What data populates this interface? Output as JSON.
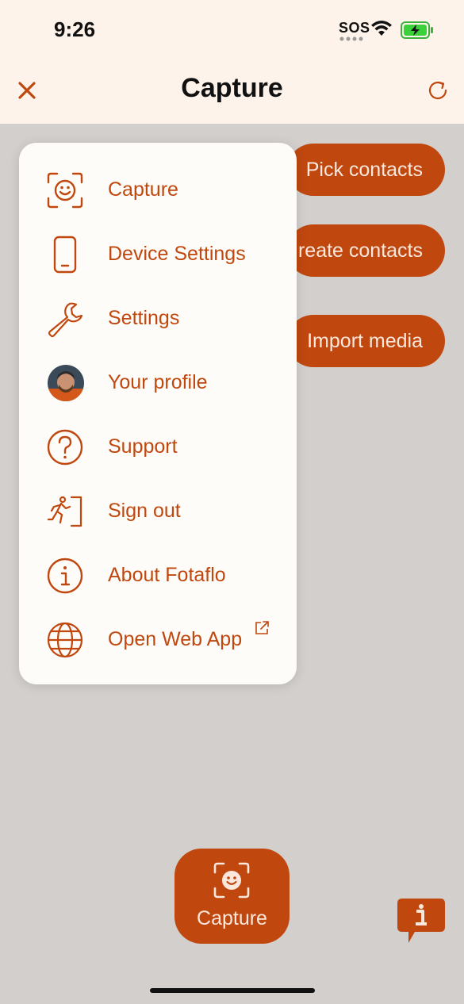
{
  "status_bar": {
    "time": "9:26",
    "sos": "SOS"
  },
  "header": {
    "title": "Capture",
    "close_icon": "close-icon",
    "refresh_icon": "refresh-icon"
  },
  "background_actions": [
    {
      "label": "Pick contacts"
    },
    {
      "label": "reate contacts"
    },
    {
      "label": "Import media"
    }
  ],
  "menu": {
    "items": [
      {
        "label": "Capture",
        "icon": "face-scan-icon"
      },
      {
        "label": "Device Settings",
        "icon": "phone-icon"
      },
      {
        "label": "Settings",
        "icon": "wrench-icon"
      },
      {
        "label": "Your profile",
        "icon": "avatar"
      },
      {
        "label": "Support",
        "icon": "question-icon"
      },
      {
        "label": "Sign out",
        "icon": "exit-icon"
      },
      {
        "label": "About Fotaflo",
        "icon": "info-icon"
      },
      {
        "label": "Open Web App",
        "icon": "globe-icon",
        "external": true
      }
    ]
  },
  "capture_button": {
    "label": "Capture",
    "icon": "face-scan-icon"
  },
  "colors": {
    "accent": "#c0480f",
    "header_bg": "#fdf3ea",
    "overlay_bg": "#d3cfcd",
    "menu_bg": "#fefcf8"
  }
}
